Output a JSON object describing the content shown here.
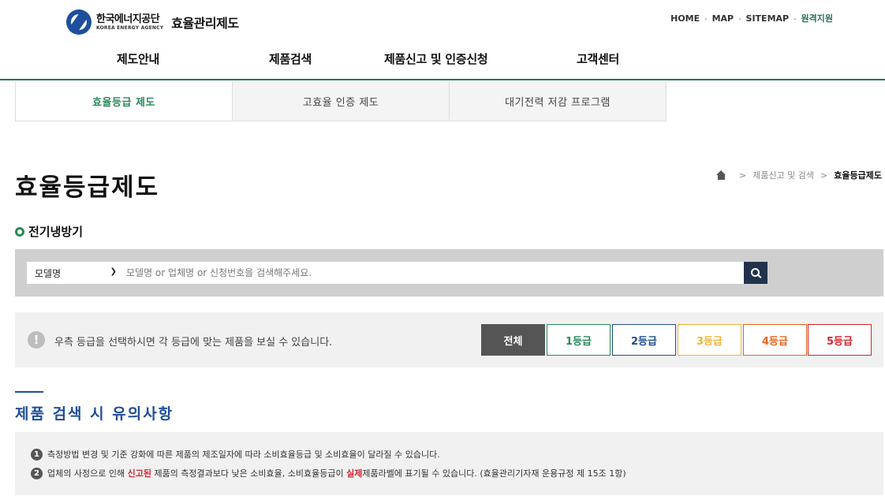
{
  "header": {
    "logo_ko": "한국에너지공단",
    "logo_en": "KOREA ENERGY AGENCY",
    "system_name": "효율관리제도",
    "util_links": [
      "HOME",
      "MAP",
      "SITEMAP",
      "원격지원"
    ]
  },
  "gnb": [
    "제도안내",
    "제품검색",
    "제품신고 및 인증신청",
    "고객센터"
  ],
  "tabs": [
    "효율등급 제도",
    "고효율 인증 제도",
    "대기전력 저감 프로그램"
  ],
  "page": {
    "title": "효율등급제도",
    "breadcrumb": [
      "제품신고 및 검색",
      "효율등급제도"
    ],
    "category": "전기냉방기"
  },
  "search": {
    "select_value": "모델명",
    "placeholder": "모델명 or 업체명 or 신청번호을 검색해주세요."
  },
  "grade_filter": {
    "message": "우측 등급을 선택하시면 각 등급에 맞는 제품을 보실 수 있습니다.",
    "buttons": [
      "전체",
      "1등급",
      "2등급",
      "3등급",
      "4등급",
      "5등급"
    ],
    "colors": [
      "#555555",
      "#2a8a5a",
      "#1f4e8c",
      "#f0b43a",
      "#e8641e",
      "#d0252e"
    ]
  },
  "notice": {
    "title": "제품 검색 시 유의사항",
    "item1": "측정방법 변경 및 기준 강화에 따른 제품의 제조일자에 따라 소비효율등급 및 소비효율이 달라질 수 있습니다.",
    "item2_a": "업체의 사정으로 인해 ",
    "item2_b": "신고된",
    "item2_c": " 제품의 측정결과보다 낮은 소비효율, 소비효율등급이 ",
    "item2_d": "실제",
    "item2_e": "제품라벨에 표기될 수 있습니다. (효율관리기자재 운용규정 제 15조 1항)"
  }
}
